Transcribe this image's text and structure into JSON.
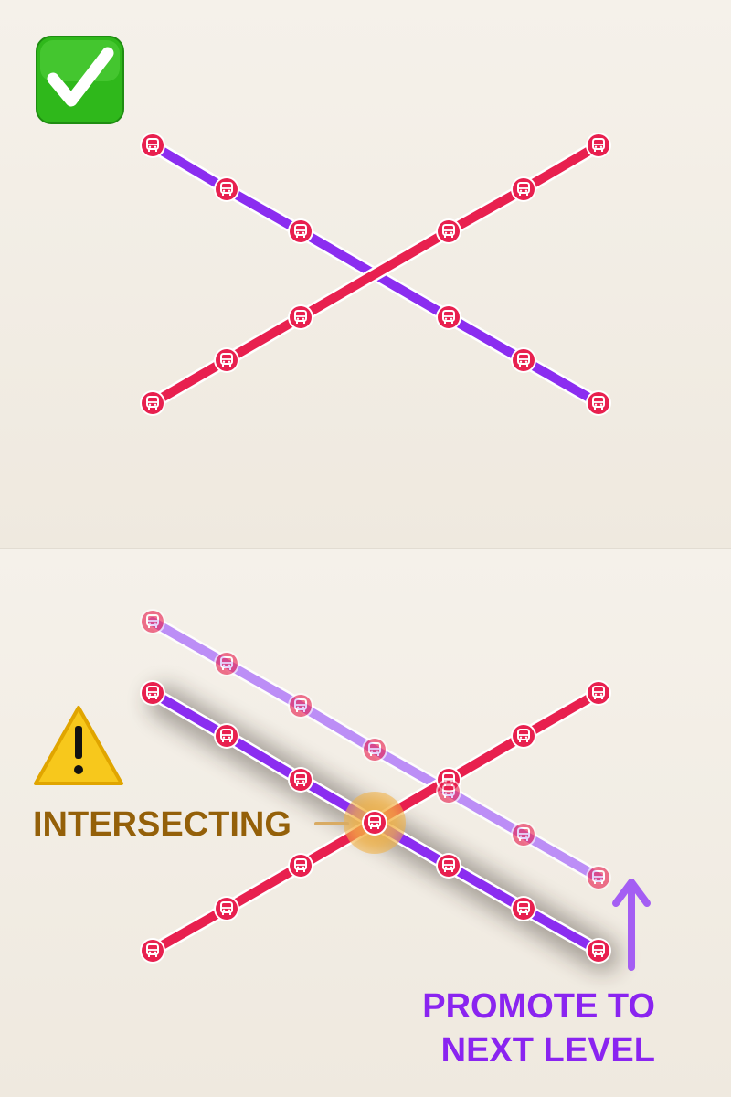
{
  "colors": {
    "background": "#f2ede4",
    "panel_divider": "#e6e1d8",
    "red_line": "#e8204f",
    "purple_line": "#8b2df0",
    "promoted_line": "#b07af5",
    "intersecting_label": "#946009",
    "promote_label": "#8a24f0",
    "check_green": "#33c21e"
  },
  "icons": {
    "ok": "check-mark-button-icon",
    "warning": "warning-sign-icon",
    "station": "bus-icon",
    "arrow": "arrow-up-icon"
  },
  "labels": {
    "intersecting": "INTERSECTING",
    "promote_line1": "PROMOTE TO",
    "promote_line2": "NEXT LEVEL"
  }
}
